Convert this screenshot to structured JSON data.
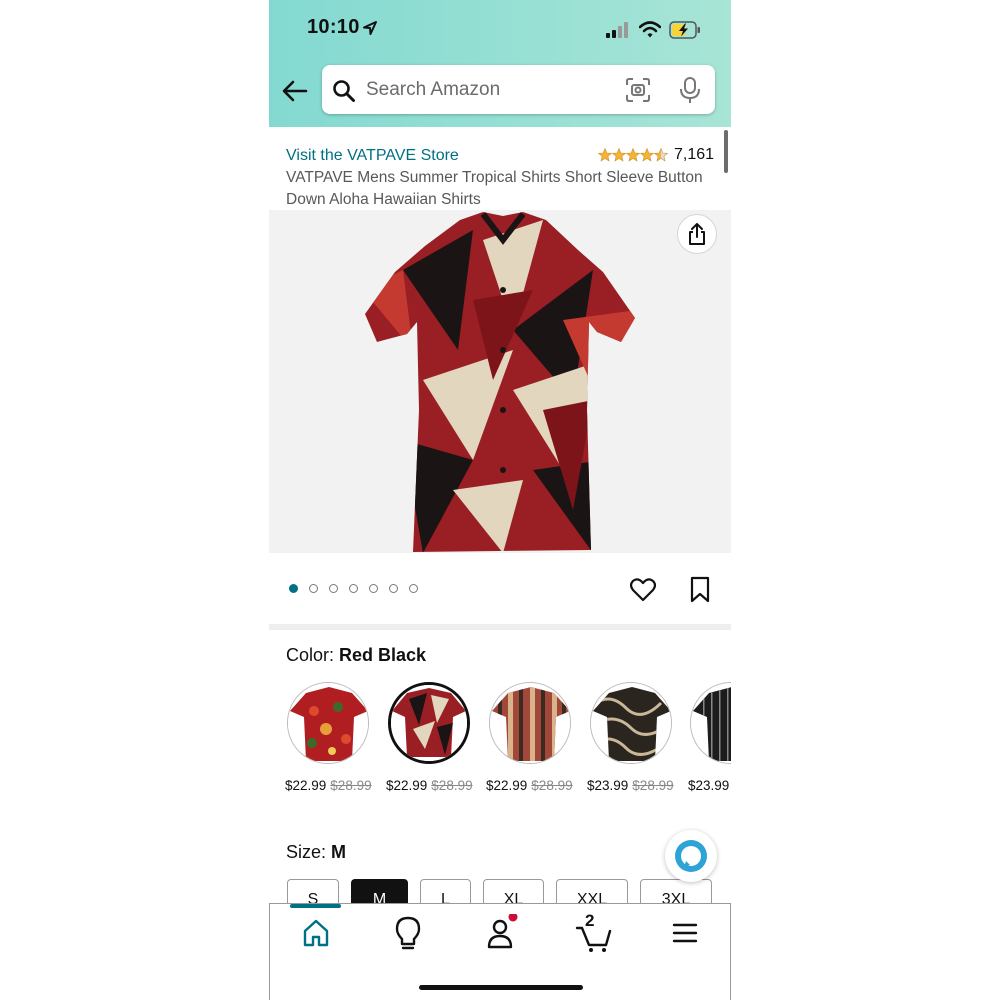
{
  "status_bar": {
    "time": "10:10"
  },
  "search": {
    "placeholder": "Search Amazon"
  },
  "product": {
    "store_link": "Visit the VATPAVE Store",
    "rating": 4.5,
    "rating_count": "7,161",
    "title": "VATPAVE Mens Summer Tropical Shirts Short Sleeve Button Down Aloha Hawaiian Shirts",
    "image_count": 7,
    "active_image": 1
  },
  "color": {
    "label": "Color:",
    "selected": "Red Black",
    "options": [
      {
        "price": "$22.99",
        "old_price": "$28.99"
      },
      {
        "price": "$22.99",
        "old_price": "$28.99"
      },
      {
        "price": "$22.99",
        "old_price": "$28.99"
      },
      {
        "price": "$23.99",
        "old_price": "$28.99"
      },
      {
        "price": "$23.99",
        "old_price": ""
      }
    ]
  },
  "size": {
    "label": "Size:",
    "selected": "M",
    "options": [
      "S",
      "M",
      "L",
      "XL",
      "XXL",
      "3XL"
    ]
  },
  "bottom_nav": {
    "items": [
      "home-icon",
      "lightbulb-icon",
      "account-icon",
      "cart-icon",
      "menu-icon"
    ],
    "cart_count": "2",
    "active": "home"
  },
  "colors": {
    "accent": "#007185",
    "header_start": "#83d9d1",
    "header_end": "#a7e5d6",
    "star": "#f5b335",
    "notification": "#cc0c39"
  }
}
